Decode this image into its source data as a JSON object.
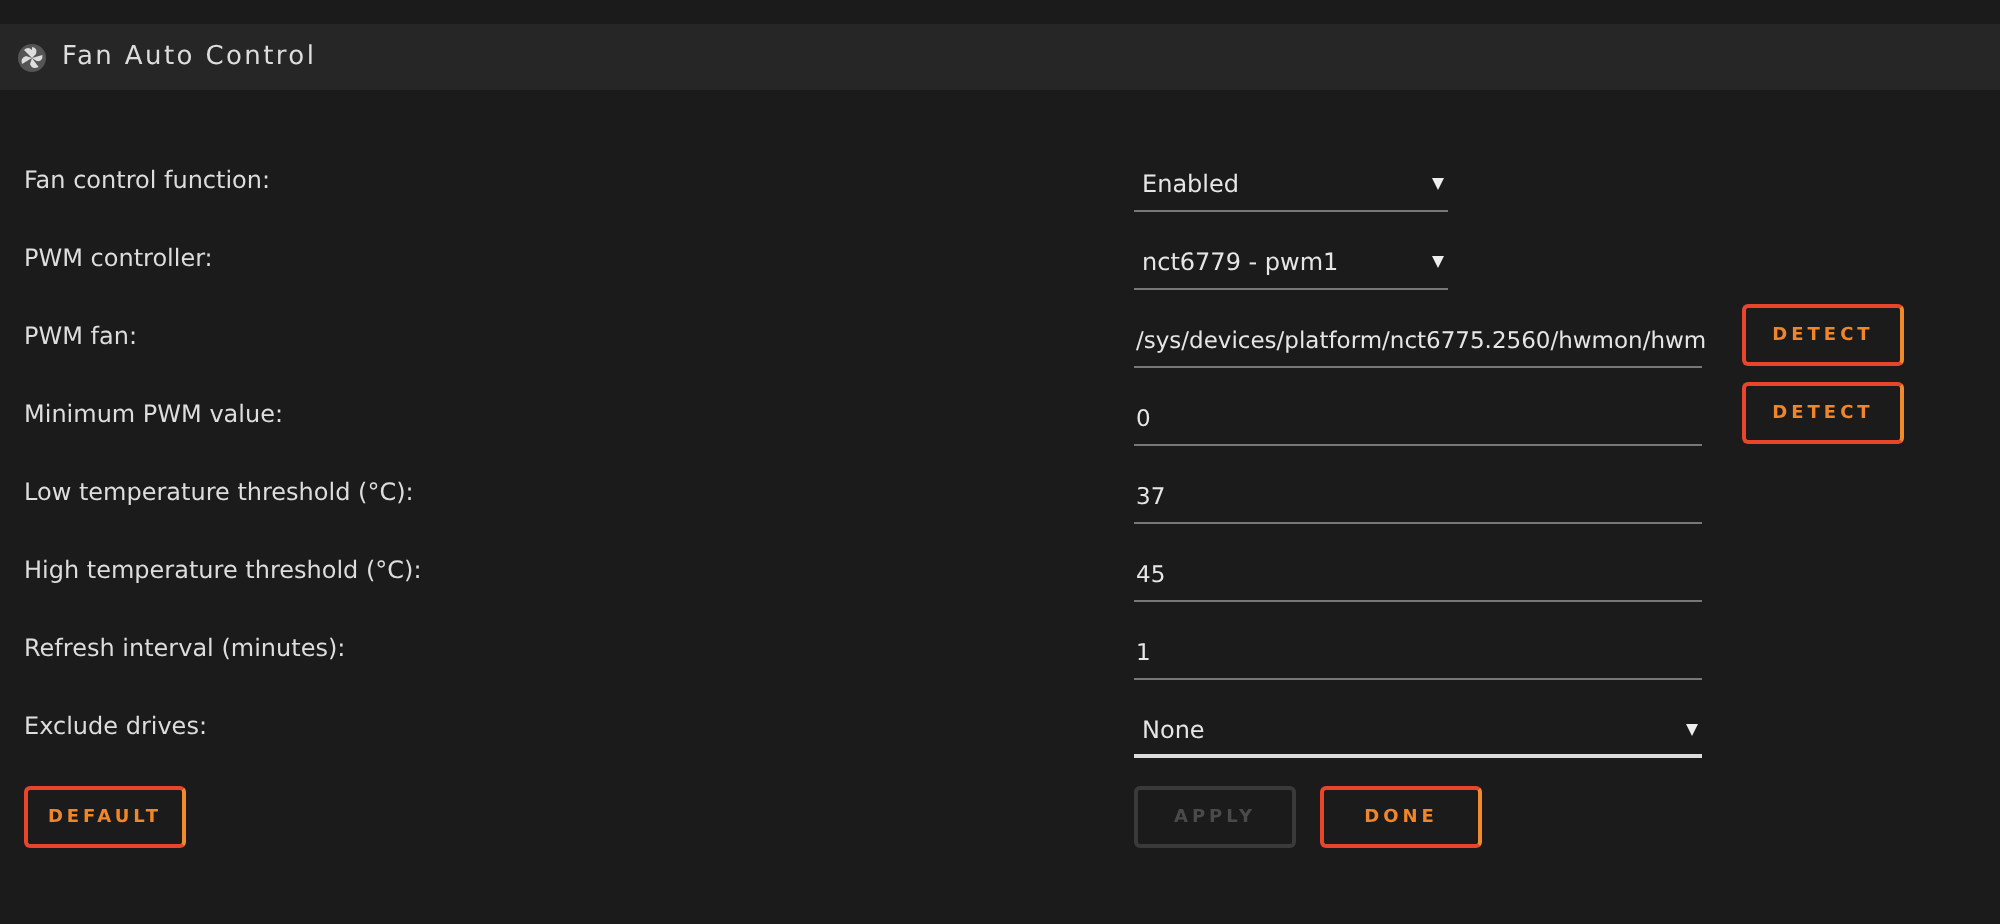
{
  "panel": {
    "title": "Fan Auto Control"
  },
  "settings": [
    {
      "label": "Fan control function:",
      "kind": "select",
      "value": "Enabled"
    },
    {
      "label": "PWM controller:",
      "kind": "select",
      "value": "nct6779 - pwm1"
    },
    {
      "label": "PWM fan:",
      "kind": "input",
      "value": "/sys/devices/platform/nct6775.2560/hwmon/hwm",
      "button": "DETECT"
    },
    {
      "label": "Minimum PWM value:",
      "kind": "input",
      "value": "0",
      "button": "DETECT"
    },
    {
      "label": "Low temperature threshold (°C):",
      "kind": "input",
      "value": "37"
    },
    {
      "label": "High temperature threshold (°C):",
      "kind": "input",
      "value": "45"
    },
    {
      "label": "Refresh interval (minutes):",
      "kind": "input",
      "value": "1"
    },
    {
      "label": "Exclude drives:",
      "kind": "multiselect",
      "value": "None"
    }
  ],
  "buttons": [
    {
      "label": "DEFAULT",
      "disabled": false
    },
    {
      "label": "APPLY",
      "disabled": true
    },
    {
      "label": "DONE",
      "disabled": false
    }
  ]
}
